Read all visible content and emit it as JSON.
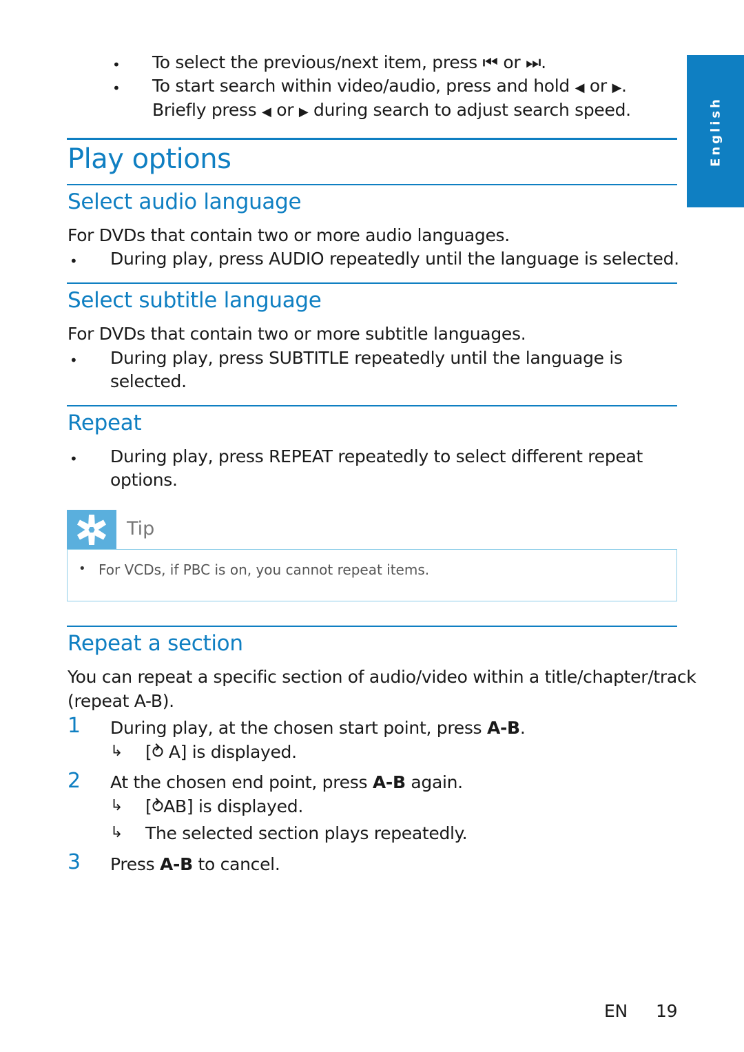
{
  "side_tab": {
    "label": "English"
  },
  "intro_bullets": [
    {
      "text_a": "To select the previous/next item, press ",
      "icon_a": "⏮",
      "mid": " or ",
      "icon_b": "⏭",
      "end": "."
    },
    {
      "text_a": "To start search within video/audio, press and hold ",
      "icon_a": "◀",
      "mid": " or ",
      "icon_b": "▶",
      "end": "."
    },
    {
      "text_a": "Briefly press ",
      "icon_a": "◀",
      "mid": " or ",
      "icon_b": "▶",
      "end": " during search to adjust search speed."
    }
  ],
  "title": "Play options",
  "sections": {
    "audio": {
      "heading": "Select audio language",
      "intro": "For DVDs that contain two or more audio languages.",
      "bullet_pre": "During play, press ",
      "bullet_key": "AUDIO",
      "bullet_post": " repeatedly until the language is selected."
    },
    "subtitle": {
      "heading": "Select subtitle language",
      "intro": "For DVDs that contain two or more subtitle languages.",
      "bullet_pre": "During play, press ",
      "bullet_key": "SUBTITLE",
      "bullet_post": " repeatedly until the language is",
      "bullet_cont": "selected."
    },
    "repeat": {
      "heading": "Repeat",
      "bullet_pre": "During play, press ",
      "bullet_key": "REPEAT",
      "bullet_post": " repeatedly to select different repeat",
      "bullet_cont": "options."
    },
    "tip": {
      "label": "Tip",
      "text": "For VCDs, if PBC is on, you cannot repeat items."
    },
    "repeat_section": {
      "heading": "Repeat a section",
      "intro_1": "You can repeat a specific section of audio/video within a title/chapter/track",
      "intro_2": "(repeat A-B).",
      "steps": [
        {
          "num": "1",
          "pre": "During play, at the chosen start point, press ",
          "key": "A-B",
          "post": ".",
          "results": [
            "[⥁ A] is displayed."
          ]
        },
        {
          "num": "2",
          "pre": "At the chosen end point, press ",
          "key": "A-B",
          "post": " again.",
          "results": [
            "[⥁AB] is displayed.",
            "The selected section plays repeatedly."
          ]
        },
        {
          "num": "3",
          "pre": "Press ",
          "key": "A-B",
          "post": " to cancel."
        }
      ]
    }
  },
  "footer": {
    "lang": "EN",
    "page": "19"
  }
}
